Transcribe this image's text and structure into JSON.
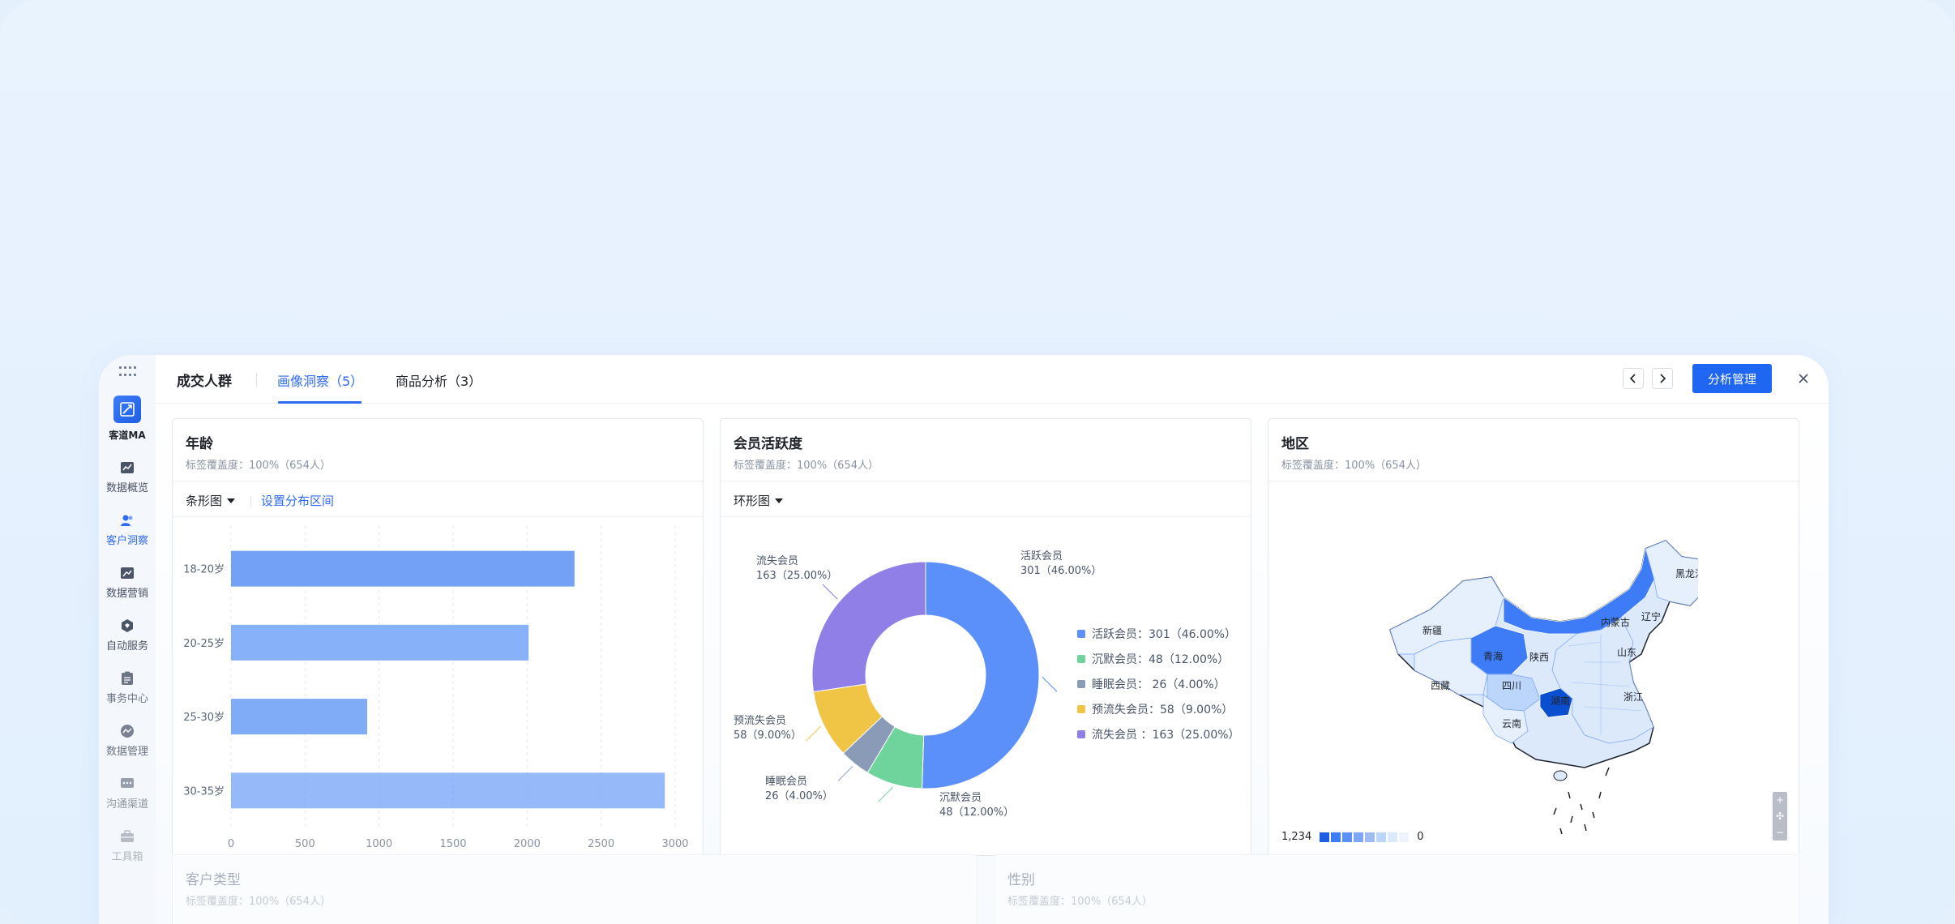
{
  "sidebar": {
    "brand_name": "客道MA",
    "items": [
      {
        "label": "数据概览",
        "icon": "chart-icon"
      },
      {
        "label": "客户洞察",
        "icon": "users-icon",
        "active": true
      },
      {
        "label": "数据营销",
        "icon": "trend-icon"
      },
      {
        "label": "自动服务",
        "icon": "hexagon-icon"
      },
      {
        "label": "事务中心",
        "icon": "clipboard-icon"
      },
      {
        "label": "数据管理",
        "icon": "data-icon"
      },
      {
        "label": "沟通渠道",
        "icon": "chat-icon"
      },
      {
        "label": "工具箱",
        "icon": "toolbox-icon"
      }
    ]
  },
  "header": {
    "title": "成交人群",
    "tabs": [
      "画像洞察（5）",
      "商品分析（3）"
    ],
    "primary_button": "分析管理"
  },
  "cards": {
    "age": {
      "title": "年龄",
      "subtitle": "标签覆盖度：100%（654人）",
      "chart_type_select": "条形图",
      "set_range_link": "设置分布区间"
    },
    "activity": {
      "title": "会员活跃度",
      "subtitle": "标签覆盖度：100%（654人）",
      "chart_type_select": "环形图"
    },
    "region": {
      "title": "地区",
      "subtitle": "标签覆盖度：100%（654人）",
      "legend_max": "1,234",
      "legend_min": "0",
      "provinces": [
        "黑龙江",
        "新疆",
        "内蒙古",
        "辽宁",
        "青海",
        "陕西",
        "山东",
        "西藏",
        "四川",
        "湖南",
        "浙江",
        "云南"
      ]
    },
    "customer_type": {
      "title": "客户类型",
      "subtitle": "标签覆盖度：100%（654人）"
    },
    "gender": {
      "title": "性别",
      "subtitle": "标签覆盖度：100%（654人）"
    }
  },
  "chart_data": [
    {
      "type": "bar",
      "orientation": "horizontal",
      "categories": [
        "18-20岁",
        "20-25岁",
        "25-30岁",
        "30-35岁"
      ],
      "values": [
        2320,
        2010,
        920,
        2930
      ],
      "xlim": [
        0,
        3000
      ],
      "xticks": [
        0,
        500,
        1000,
        1500,
        2000,
        2500,
        3000
      ],
      "color": "#6a9cf6",
      "grid": true
    },
    {
      "type": "pie",
      "donut": true,
      "slices": [
        {
          "name": "活跃会员",
          "value": 301,
          "percent": "46.00%",
          "color": "#5b8ff9",
          "legend": "活跃会员：301（46.00%）",
          "label_line1": "活跃会员",
          "label_line2": "301（46.00%）"
        },
        {
          "name": "沉默会员",
          "value": 48,
          "percent": "12.00%",
          "color": "#6fd49c",
          "legend": "沉默会员：48（12.00%）",
          "label_line1": "沉默会员",
          "label_line2": "48（12.00%）"
        },
        {
          "name": "睡眠会员",
          "value": 26,
          "percent": "4.00%",
          "color": "#8a9bb7",
          "legend": "睡眠会员： 26（4.00%）",
          "label_line1": "睡眠会员",
          "label_line2": "26（4.00%）"
        },
        {
          "name": "预流失会员",
          "value": 58,
          "percent": "9.00%",
          "color": "#f0c445",
          "legend": "预流失会员：58（9.00%）",
          "label_line1": "预流失会员",
          "label_line2": "58（9.00%）"
        },
        {
          "name": "流失会员",
          "value": 163,
          "percent": "25.00%",
          "color": "#8f7fe6",
          "legend": "流失会员 ：163（25.00%）",
          "label_line1": "流失会员",
          "label_line2": "163（25.00%）"
        }
      ],
      "legend_position": "right"
    }
  ]
}
